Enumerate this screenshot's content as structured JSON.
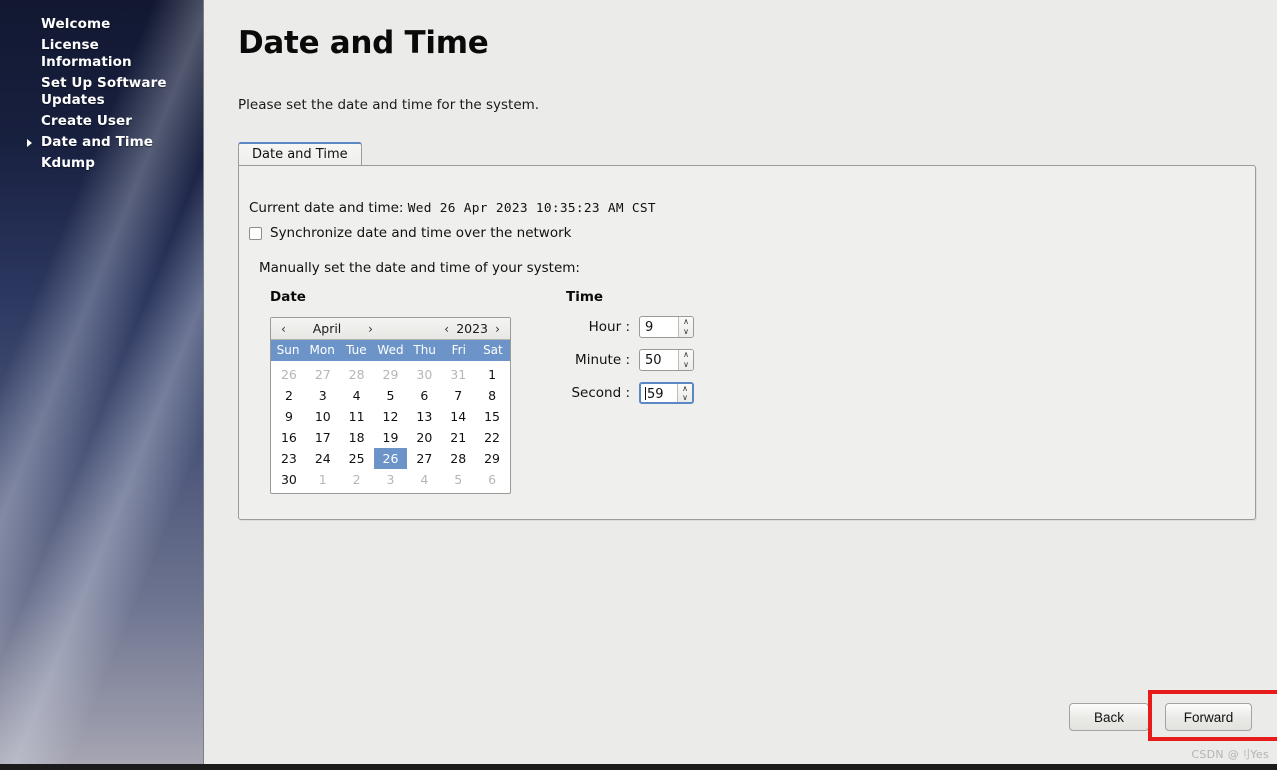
{
  "sidebar": {
    "items": [
      {
        "label": "Welcome",
        "active": false
      },
      {
        "label": "License Information",
        "active": false
      },
      {
        "label": "Set Up Software Updates",
        "active": false
      },
      {
        "label": "Create User",
        "active": false
      },
      {
        "label": "Date and Time",
        "active": true
      },
      {
        "label": "Kdump",
        "active": false
      }
    ]
  },
  "page": {
    "title": "Date and Time",
    "subtitle": "Please set the date and time for the system."
  },
  "tabs": [
    {
      "label": "Date and Time",
      "active": true
    }
  ],
  "panel": {
    "current_label": "Current date and time:",
    "current_value": "Wed 26 Apr 2023 10:35:23 AM CST",
    "sync_label": "Synchronize date and time over the network",
    "sync_checked": false,
    "manual_label": "Manually set the date and time of your system:"
  },
  "date": {
    "heading": "Date",
    "prev_month_icon": "‹",
    "next_month_icon": "›",
    "prev_year_icon": "‹",
    "next_year_icon": "›",
    "month": "April",
    "year": "2023",
    "dow": [
      "Sun",
      "Mon",
      "Tue",
      "Wed",
      "Thu",
      "Fri",
      "Sat"
    ],
    "selected_day": 26,
    "weeks": [
      [
        {
          "d": "26",
          "dim": true
        },
        {
          "d": "27",
          "dim": true
        },
        {
          "d": "28",
          "dim": true
        },
        {
          "d": "29",
          "dim": true
        },
        {
          "d": "30",
          "dim": true
        },
        {
          "d": "31",
          "dim": true
        },
        {
          "d": "1",
          "dim": false
        }
      ],
      [
        {
          "d": "2",
          "dim": false
        },
        {
          "d": "3",
          "dim": false
        },
        {
          "d": "4",
          "dim": false
        },
        {
          "d": "5",
          "dim": false
        },
        {
          "d": "6",
          "dim": false
        },
        {
          "d": "7",
          "dim": false
        },
        {
          "d": "8",
          "dim": false
        }
      ],
      [
        {
          "d": "9",
          "dim": false
        },
        {
          "d": "10",
          "dim": false
        },
        {
          "d": "11",
          "dim": false
        },
        {
          "d": "12",
          "dim": false
        },
        {
          "d": "13",
          "dim": false
        },
        {
          "d": "14",
          "dim": false
        },
        {
          "d": "15",
          "dim": false
        }
      ],
      [
        {
          "d": "16",
          "dim": false
        },
        {
          "d": "17",
          "dim": false
        },
        {
          "d": "18",
          "dim": false
        },
        {
          "d": "19",
          "dim": false
        },
        {
          "d": "20",
          "dim": false
        },
        {
          "d": "21",
          "dim": false
        },
        {
          "d": "22",
          "dim": false
        }
      ],
      [
        {
          "d": "23",
          "dim": false
        },
        {
          "d": "24",
          "dim": false
        },
        {
          "d": "25",
          "dim": false
        },
        {
          "d": "26",
          "dim": false,
          "selected": true
        },
        {
          "d": "27",
          "dim": false
        },
        {
          "d": "28",
          "dim": false
        },
        {
          "d": "29",
          "dim": false
        }
      ],
      [
        {
          "d": "30",
          "dim": false
        },
        {
          "d": "1",
          "dim": true
        },
        {
          "d": "2",
          "dim": true
        },
        {
          "d": "3",
          "dim": true
        },
        {
          "d": "4",
          "dim": true
        },
        {
          "d": "5",
          "dim": true
        },
        {
          "d": "6",
          "dim": true
        }
      ]
    ]
  },
  "time": {
    "heading": "Time",
    "fields": [
      {
        "label": "Hour :",
        "value": "9",
        "focused": false
      },
      {
        "label": "Minute :",
        "value": "50",
        "focused": false
      },
      {
        "label": "Second :",
        "value": "59",
        "focused": true
      }
    ],
    "up_icon": "∧",
    "down_icon": "∨"
  },
  "footer": {
    "back_label": "Back",
    "forward_label": "Forward"
  },
  "watermark": "CSDN @刂Yes",
  "colors": {
    "accent_blue": "#6c94c9",
    "tab_accent": "#5b87c4",
    "highlight_red": "#e81b1b",
    "content_bg": "#ebebe9"
  }
}
